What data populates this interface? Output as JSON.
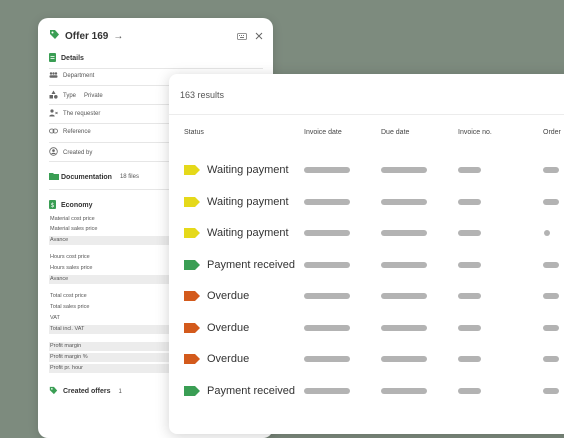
{
  "offer": {
    "title": "Offer 169",
    "sections": {
      "details": "Details",
      "documentation": "Documentation",
      "documentation_count": "18 files",
      "economy": "Economy",
      "created_offers": "Created offers",
      "created_offers_count": "1"
    },
    "fields": {
      "department": "Department",
      "type": "Type",
      "type_value": "Private",
      "requester": "The requester",
      "reference": "Reference",
      "created_by": "Created by"
    },
    "economy_lines": [
      "Material cost price",
      "Material sales price",
      "Avance",
      "Hours cost price",
      "Hours sales price",
      "Avance",
      "Total cost price",
      "Total sales price",
      "VAT",
      "Total incl. VAT",
      "Profit margin",
      "Profit margin %",
      "Profit pr. hour"
    ]
  },
  "results": {
    "count_text": "163 results",
    "columns": [
      "Status",
      "Invoice date",
      "Due date",
      "Invoice no.",
      "Order"
    ],
    "rows": [
      {
        "status": "Waiting payment",
        "color": "#e5d91a"
      },
      {
        "status": "Waiting payment",
        "color": "#e5d91a"
      },
      {
        "status": "Waiting payment",
        "color": "#e5d91a"
      },
      {
        "status": "Payment received",
        "color": "#3a9e54"
      },
      {
        "status": "Overdue",
        "color": "#d35a1c"
      },
      {
        "status": "Overdue",
        "color": "#d35a1c"
      },
      {
        "status": "Overdue",
        "color": "#d35a1c"
      },
      {
        "status": "Payment received",
        "color": "#3a9e54"
      }
    ]
  },
  "colors": {
    "brand_green": "#3a9e54",
    "background": "#7d8b7e"
  }
}
